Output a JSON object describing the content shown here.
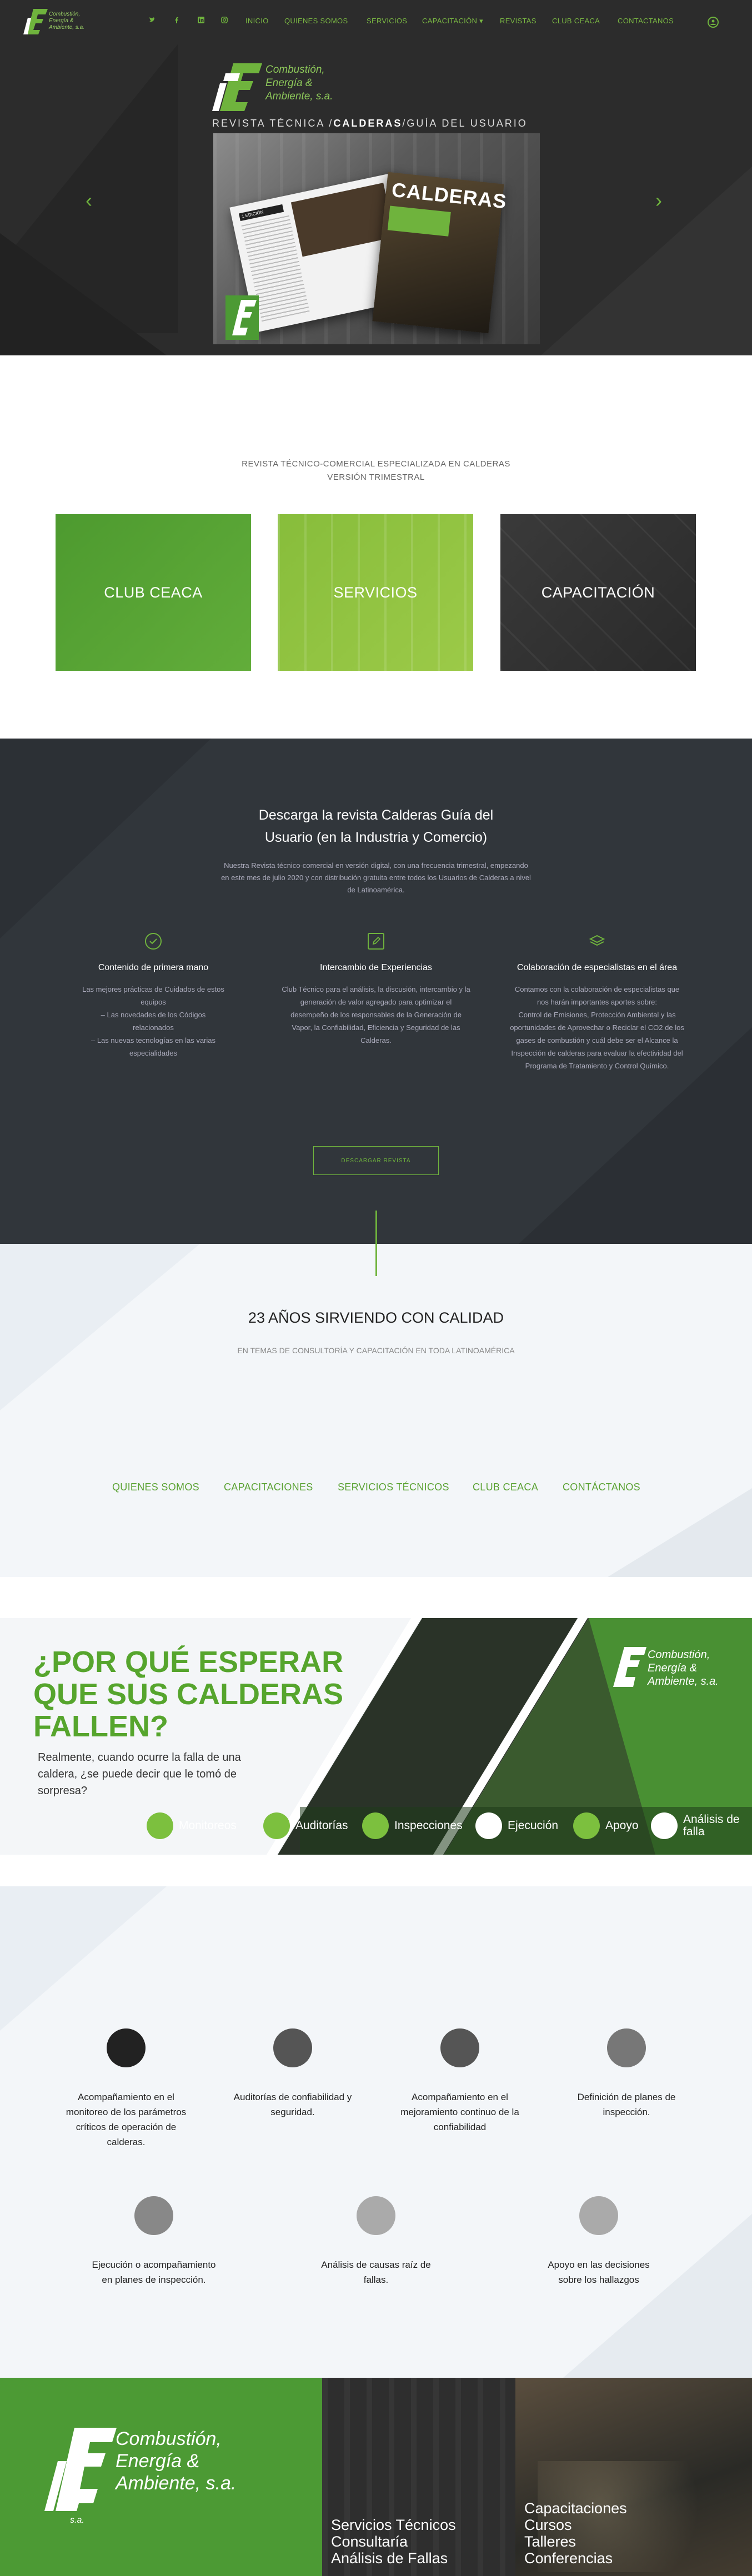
{
  "colors": {
    "brand_green": "#6fb33d",
    "dark": "#2c2c2c",
    "light_bg": "#f3f6f9"
  },
  "header": {
    "logo_text": [
      "Combustión,",
      "Energía &",
      "Ambiente, s.a."
    ],
    "social_icons": [
      "twitter-icon",
      "facebook-icon",
      "linkedin-icon",
      "instagram-icon"
    ],
    "menu": [
      "INICIO",
      "QUIENES SOMOS",
      "SERVICIOS",
      "CAPACITACIÓN",
      "REVISTAS",
      "CLUB CEACA",
      "CONTACTANOS"
    ],
    "capacitacion_caret": "▾"
  },
  "hero": {
    "brand_line1": "Combustión,",
    "brand_line2": "Energía &",
    "brand_line3": "Ambiente, s.a.",
    "caption_pre": "REVISTA TÉCNICA /",
    "caption_bold": "CALDERAS",
    "caption_post": "/GUÍA DEL USUARIO",
    "magazine_title": "CALDERAS",
    "magazine_edition": "1 EDICIÓN",
    "prev_arrow": "‹",
    "next_arrow": "›"
  },
  "intro": {
    "line1": "REVISTA TÉCNICO-COMERCIAL ESPECIALIZADA EN CALDERAS",
    "line2": "VERSIÓN TRIMESTRAL",
    "cards": [
      "CLUB CEACA",
      "SERVICIOS",
      "CAPACITACIÓN"
    ]
  },
  "download": {
    "title": "Descarga la revista Calderas Guía del Usuario (en la Industria y Comercio)",
    "description": "Nuestra Revista técnico-comercial en versión digital, con una frecuencia trimestral, empezando en este mes de julio 2020 y con distribución gratuita entre todos los Usuarios de Calderas a nivel de Latinoamérica.",
    "features": [
      {
        "title": "Contenido de primera mano",
        "text": "Las mejores prácticas de Cuidados de estos equipos\n– Las novedades de los Códigos relacionados\n– Las nuevas tecnologías en las varias especialidades"
      },
      {
        "title": "Intercambio de Experiencias",
        "text": "Club Técnico para el análisis, la discusión, intercambio y la generación de valor agregado para optimizar el desempeño de los responsables de la Generación de Vapor, la Confiabilidad, Eficiencia y Seguridad de las Calderas."
      },
      {
        "title": "Colaboración de especialistas en el área",
        "text": "Contamos con la colaboración de especialistas que nos harán importantes aportes sobre:\nControl de Emisiones, Protección Ambiental y las oportunidades de Aprovechar o Reciclar el CO2 de los gases de combustión y cuál debe ser el Alcance la Inspección de calderas para evaluar la efectividad del Programa de Tratamiento y Control Químico."
      }
    ],
    "button": "DESCARGAR REVISTA"
  },
  "quality": {
    "title": "23 AÑOS SIRVIENDO CON CALIDAD",
    "subtitle": "EN TEMAS DE CONSULTORÍA Y CAPACITACIÓN EN TODA LATINOAMÉRICA",
    "links": [
      "QUIENES SOMOS",
      "CAPACITACIONES",
      "SERVICIOS TÉCNICOS",
      "CLUB CEACA",
      "CONTÁCTANOS"
    ]
  },
  "banner": {
    "headline": "¿POR QUÉ ESPERAR QUE SUS CALDERAS FALLEN?",
    "text": "Realmente, cuando ocurre la falla de una caldera, ¿se puede decir que le tomó de sorpresa?",
    "items": [
      "Monitoreos",
      "Auditorías",
      "Inspecciones",
      "Ejecución",
      "Apoyo",
      "Análisis de falla"
    ],
    "logo_text": [
      "Combustión,",
      "Energía &",
      "Ambiente, s.a."
    ]
  },
  "services": [
    "Acompañamiento en el monitoreo de los parámetros críticos de operación de calderas.",
    "Auditorías de confiabilidad y seguridad.",
    "Acompañamiento en el mejoramiento continuo de la confiabilidad",
    "Definición de planes de inspección.",
    "Ejecución o acompañamiento en planes de inspección.",
    "Análisis de causas raíz de fallas.",
    "Apoyo en las decisiones sobre los hallazgos"
  ],
  "footer": {
    "logo_text": [
      "Combustión,",
      "Energía &",
      "Ambiente, s.a."
    ],
    "logo_sa": "s.a.",
    "col1": [
      "Servicios Técnicos",
      "Consultaría",
      "Análisis de Fallas"
    ],
    "col2": [
      "Capacitaciones",
      "Cursos",
      "Talleres",
      "Conferencias"
    ]
  }
}
